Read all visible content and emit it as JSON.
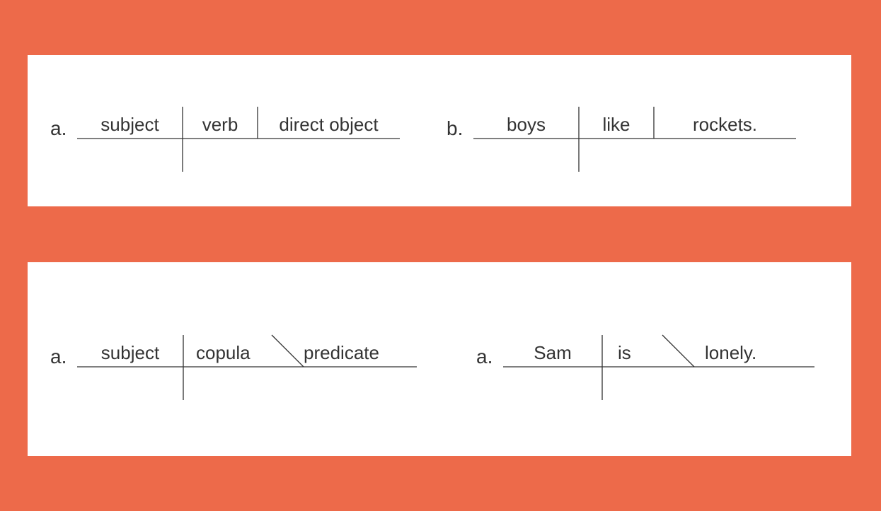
{
  "panels": [
    {
      "diagrams": [
        {
          "label": "a.",
          "slots": [
            "subject",
            "verb",
            "direct object"
          ],
          "separators": [
            "tall_vertical",
            "short_vertical"
          ]
        },
        {
          "label": "b.",
          "slots": [
            "boys",
            "like",
            "rockets."
          ],
          "separators": [
            "tall_vertical",
            "short_vertical"
          ]
        }
      ]
    },
    {
      "diagrams": [
        {
          "label": "a.",
          "slots": [
            "subject",
            "copula",
            "predicate"
          ],
          "separators": [
            "tall_vertical",
            "backslash"
          ]
        },
        {
          "label": "a.",
          "slots": [
            "Sam",
            "is",
            "lonely."
          ],
          "separators": [
            "tall_vertical",
            "backslash"
          ]
        }
      ]
    }
  ]
}
